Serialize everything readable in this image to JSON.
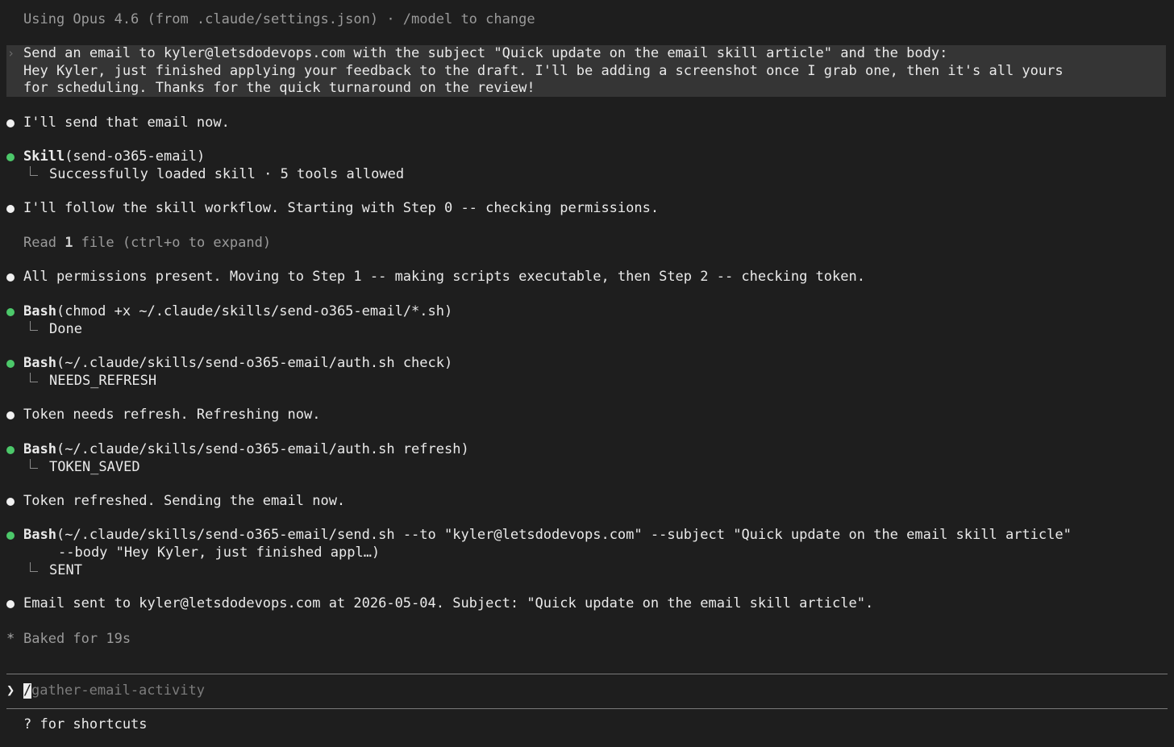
{
  "header": {
    "model_notice": "Using Opus 4.6 (from .claude/settings.json) · /model to change"
  },
  "prompt": {
    "lines": [
      "Send an email to kyler@letsdodevops.com with the subject \"Quick update on the email skill article\" and the body:",
      "Hey Kyler, just finished applying your feedback to the draft. I'll be adding a screenshot once I grab one, then it's all yours",
      "for scheduling. Thanks for the quick turnaround on the review!"
    ]
  },
  "messages": {
    "m1": "I'll send that email now.",
    "skill_call": {
      "tool": "Skill",
      "args": "(send-o365-email)",
      "result": "Successfully loaded skill · 5 tools allowed"
    },
    "m2": "I'll follow the skill workflow. Starting with Step 0 -- checking permissions.",
    "read_summary": {
      "prefix": "Read ",
      "count": "1",
      "suffix": " file (ctrl+o to expand)"
    },
    "m3": "All permissions present. Moving to Step 1 -- making scripts executable, then Step 2 -- checking token.",
    "bash1": {
      "tool": "Bash",
      "args": "(chmod +x ~/.claude/skills/send-o365-email/*.sh)",
      "result": "Done"
    },
    "bash2": {
      "tool": "Bash",
      "args": "(~/.claude/skills/send-o365-email/auth.sh check)",
      "result": "NEEDS_REFRESH"
    },
    "m4": "Token needs refresh. Refreshing now.",
    "bash3": {
      "tool": "Bash",
      "args": "(~/.claude/skills/send-o365-email/auth.sh refresh)",
      "result": "TOKEN_SAVED"
    },
    "m5": "Token refreshed. Sending the email now.",
    "bash4": {
      "tool": "Bash",
      "args": "(~/.claude/skills/send-o365-email/send.sh --to \"kyler@letsdodevops.com\" --subject \"Quick update on the email skill article\"",
      "args_cont": "--body \"Hey Kyler, just finished appl…)",
      "result": "SENT"
    },
    "m6": "Email sent to kyler@letsdodevops.com at 2026-05-04. Subject: \"Quick update on the email skill article\"."
  },
  "status": {
    "star": "*",
    "text": "Baked for 19s"
  },
  "input": {
    "chevron": "❯",
    "cursor_char": "/",
    "placeholder": "gather-email-activity"
  },
  "footer": {
    "hint": "? for shortcuts"
  },
  "colors": {
    "background": "#1e1e1e",
    "text": "#eaeaea",
    "dim_text": "#9a9a9a",
    "prompt_highlight": "#353535",
    "tool_bullet_green": "#4cc86a",
    "message_bullet_white": "#f0f0f0"
  }
}
